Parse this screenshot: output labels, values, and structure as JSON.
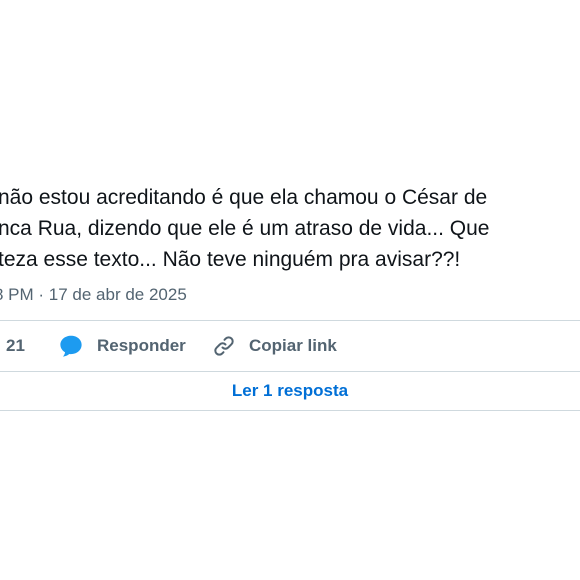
{
  "tweet": {
    "lines": [
      "não estou acreditando é que ela chamou o César de",
      "nca Rua, dizendo que ele é um atraso de vida... Que",
      "teza esse texto... Não teve ninguém pra avisar??!"
    ],
    "timestamp": "8 PM · 17 de abr de 2025"
  },
  "actions": {
    "like_count": "21",
    "reply_label": "Responder",
    "copy_link_label": "Copiar link"
  },
  "replies": {
    "read_label": "Ler 1 resposta"
  },
  "colors": {
    "text": "#0f1419",
    "muted": "#536471",
    "accent": "#1d9bf0",
    "link": "#006fd6",
    "divider": "#cfd9de"
  },
  "icons": {
    "reply": "speech-bubble-icon",
    "copy_link": "link-chain-icon"
  }
}
